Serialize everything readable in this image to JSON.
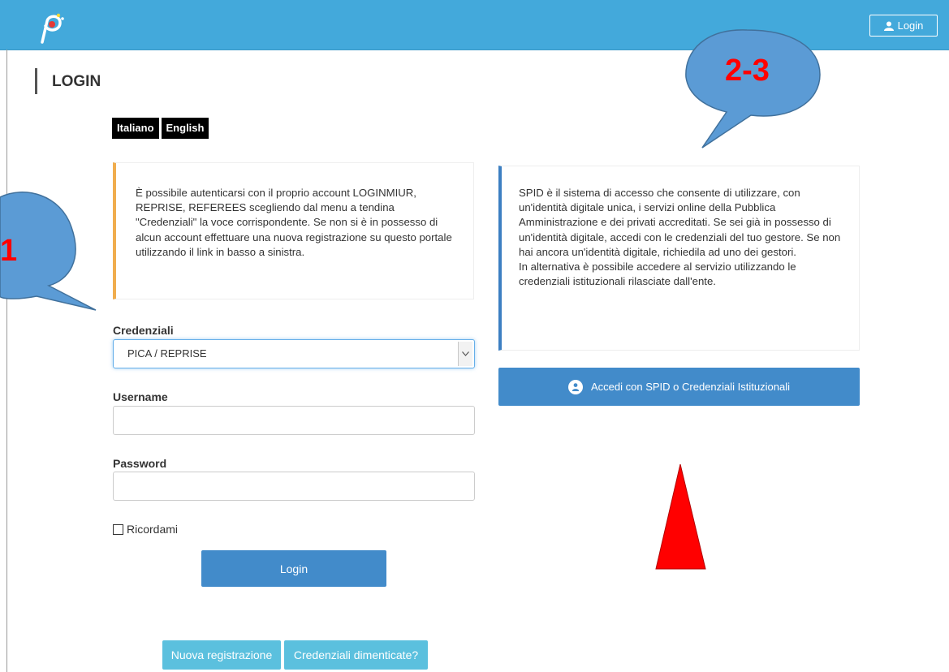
{
  "header": {
    "login_button": "Login"
  },
  "page": {
    "title": "LOGIN"
  },
  "languages": [
    "Italiano",
    "English"
  ],
  "info_left": "È possibile autenticarsi con il proprio account LOGINMIUR, REPRISE, REFEREES scegliendo dal menu a tendina \"Credenziali\" la voce corrispondente. Se non si è in possesso di alcun account effettuare una nuova registrazione su questo portale utilizzando il link in basso a sinistra.",
  "info_right": {
    "para1": "SPID è il sistema di accesso che consente di utilizzare, con un'identità digitale unica, i servizi online della Pubblica Amministrazione e dei privati accreditati. Se sei già in possesso di un'identità digitale, accedi con le credenziali del tuo gestore. Se non hai ancora un'identità digitale, richiedila ad uno dei gestori.",
    "para2": "In alternativa è possibile accedere al servizio utilizzando le credenziali istituzionali rilasciate dall'ente."
  },
  "form": {
    "credentials_label": "Credenziali",
    "credentials_value": "PICA / REPRISE",
    "username_label": "Username",
    "username_value": "",
    "password_label": "Password",
    "password_value": "",
    "remember_label": "Ricordami",
    "login_button": "Login"
  },
  "spid_button": "Accedi con SPID o Credenziali Istituzionali",
  "footer": {
    "register_button": "Nuova registrazione",
    "forgot_button": "Credenziali dimenticate?"
  },
  "annotations": {
    "callout_1": "1",
    "callout_2": "2-3"
  },
  "colors": {
    "header": "#43a9db",
    "primary": "#428bca",
    "info": "#5bc0de",
    "warning_border": "#f0ad4e",
    "callout_fill": "#5b9bd5",
    "callout_text": "#ff0000",
    "arrow": "#ff0000"
  }
}
